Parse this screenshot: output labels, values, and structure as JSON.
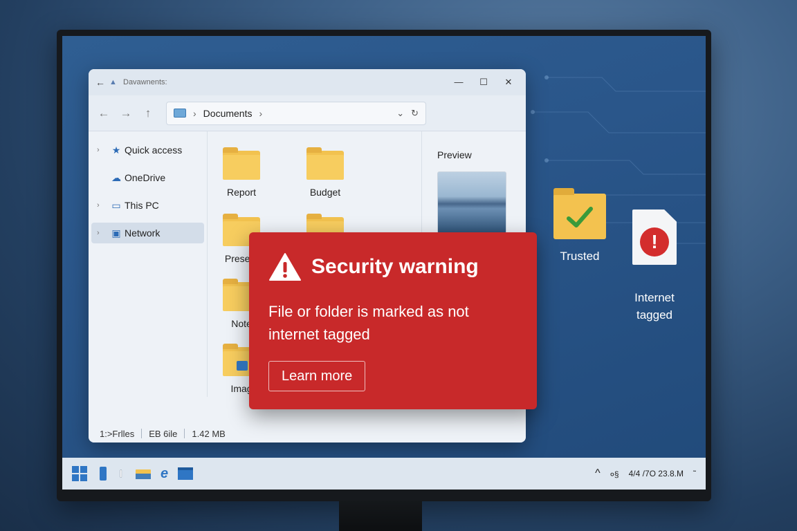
{
  "explorer": {
    "title": "Davawnents:",
    "address": {
      "crumb": "Documents",
      "separator_icon": "chevron-right-icon"
    },
    "sidebar": [
      {
        "label": "Quick access",
        "icon": "star-icon",
        "expandable": true
      },
      {
        "label": "OneDrive",
        "icon": "cloud-icon",
        "expandable": false
      },
      {
        "label": "This PC",
        "icon": "monitor-icon",
        "expandable": true
      },
      {
        "label": "Network",
        "icon": "network-icon",
        "expandable": true,
        "selected": true
      }
    ],
    "files": [
      {
        "label": "Report"
      },
      {
        "label": "Budget"
      },
      {
        "label": "Present"
      },
      {
        "label": ""
      },
      {
        "label": "Note"
      },
      {
        "label": "Imag"
      }
    ],
    "preview": {
      "title": "Preview"
    },
    "status": {
      "items": "1:>Frlles",
      "selected": "EB 6ile",
      "size": "1.42 MB"
    }
  },
  "desktop": {
    "icons": [
      {
        "label": "Trusted",
        "icon": "folder-check-icon"
      },
      {
        "label": "Internet\ntagged",
        "icon": "document-error-icon"
      }
    ]
  },
  "warning": {
    "title": "Security warning",
    "message": "File or folder is marked as not internet tagged",
    "button": "Learn more"
  },
  "taskbar": {
    "clock": "4/4 /7O 23.8.M",
    "tray_icon": "^",
    "tray_misc": "०§"
  },
  "colors": {
    "warning": "#c8292a",
    "accent": "#2f76c4",
    "folder": "#f2c24f"
  }
}
